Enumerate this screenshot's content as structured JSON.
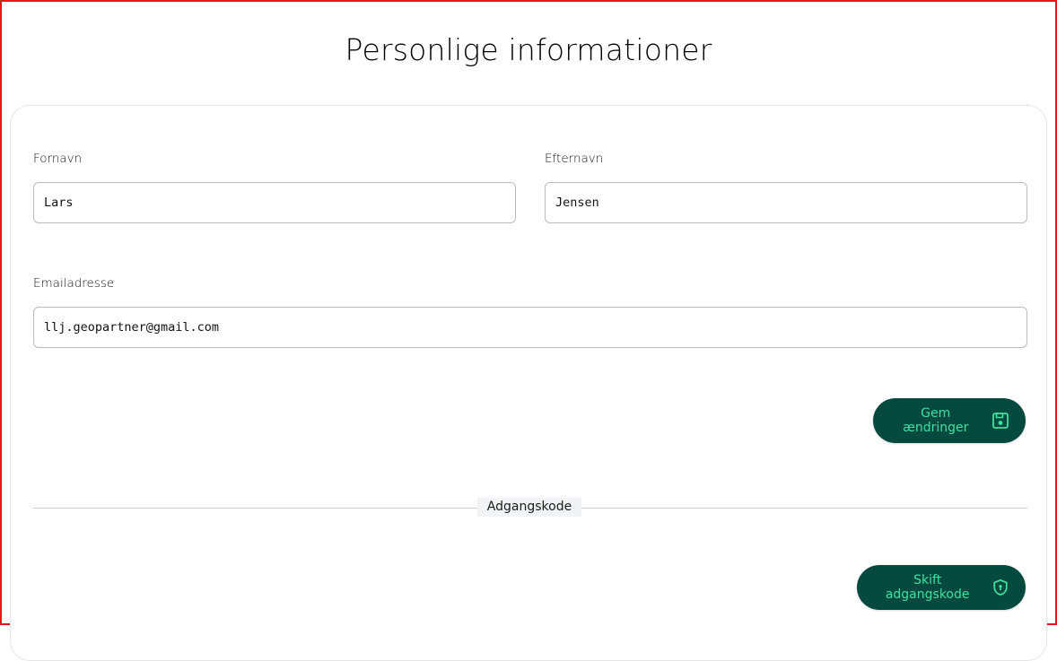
{
  "page": {
    "title": "Personlige informationer"
  },
  "form": {
    "first_name": {
      "label": "Fornavn",
      "value": "Lars"
    },
    "last_name": {
      "label": "Efternavn",
      "value": "Jensen"
    },
    "email": {
      "label": "Emailadresse",
      "value": "llj.geopartner@gmail.com"
    },
    "save_button": {
      "label": "Gem ændringer",
      "icon": "save-icon"
    }
  },
  "password_section": {
    "divider_label": "Adgangskode",
    "change_button": {
      "label": "Skift adgangskode",
      "icon": "shield-lock-icon"
    }
  },
  "colors": {
    "button_bg": "#064a3f",
    "button_text": "#3fe0a0",
    "frame_border": "#e8141b"
  }
}
